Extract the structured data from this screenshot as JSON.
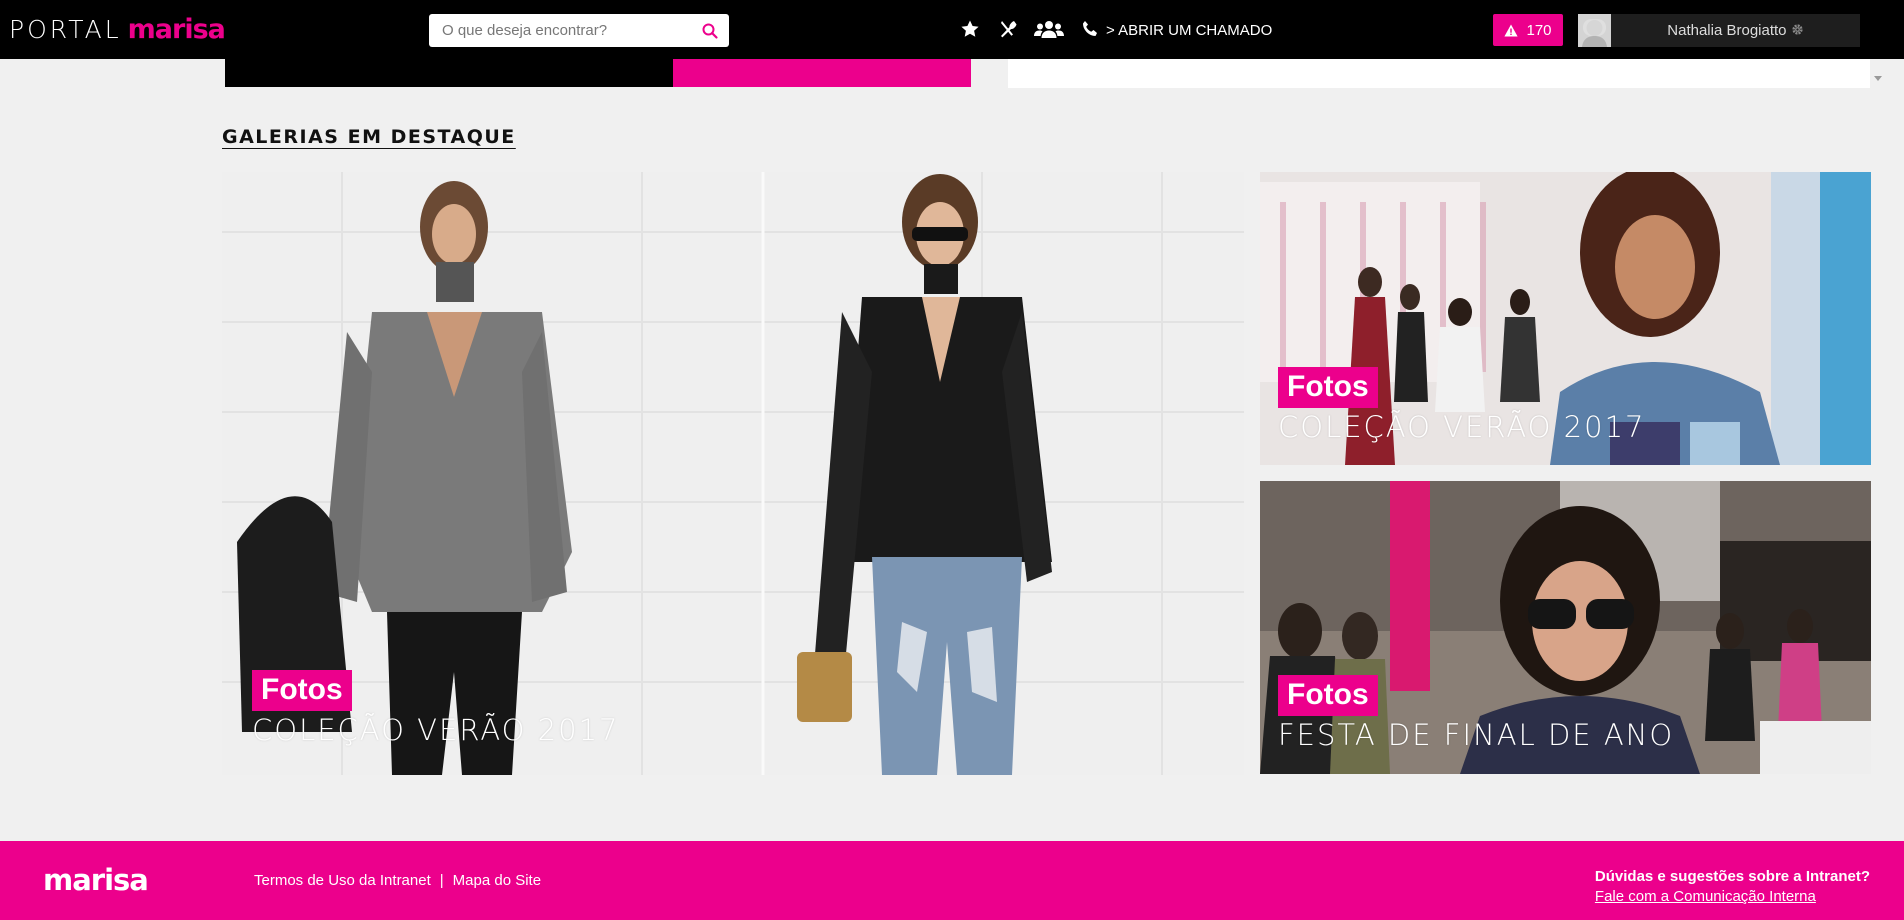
{
  "header": {
    "logo_portal": "PORTAL",
    "logo_brand": "marisa",
    "search_placeholder": "O que deseja encontrar?",
    "chamado_link": "> ABRIR UM CHAMADO",
    "alert_count": "170",
    "user_name": "Nathalia Brogiatto",
    "icons": [
      "star-icon",
      "utensils-icon",
      "users-icon",
      "phone-icon"
    ]
  },
  "gallery": {
    "section_title": "GALERIAS EM DESTAQUE",
    "tiles": [
      {
        "badge": "Fotos",
        "title": "COLEÇÃO VERÃO 2017"
      },
      {
        "badge": "Fotos",
        "title": "COLEÇÃO VERÃO 2017"
      },
      {
        "badge": "Fotos",
        "title": "FESTA DE FINAL DE ANO"
      }
    ]
  },
  "footer": {
    "logo": "marisa",
    "terms": "Termos de Uso da Intranet",
    "separator": "|",
    "sitemap": "Mapa do Site",
    "help_question": "Dúvidas e sugestões sobre a Intranet?",
    "help_link": "Fale com a Comunicação Interna"
  },
  "colors": {
    "brand_pink": "#ec008c",
    "header_bg": "#000000",
    "page_bg": "#f0f0f0"
  }
}
